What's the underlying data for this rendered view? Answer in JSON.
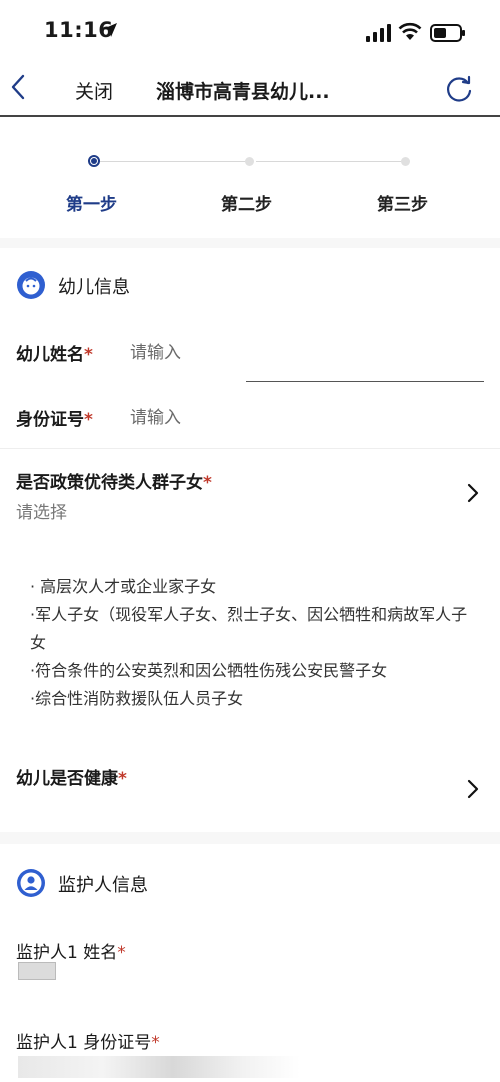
{
  "status_bar": {
    "time": "11:16"
  },
  "nav": {
    "close_label": "关闭",
    "title": "淄博市高青县幼儿..."
  },
  "steps": [
    {
      "label": "第一步",
      "active": true
    },
    {
      "label": "第二步",
      "active": false
    },
    {
      "label": "第三步",
      "active": false
    }
  ],
  "child_section": {
    "title": "幼儿信息",
    "name_label": "幼儿姓名",
    "name_placeholder": "请输入",
    "id_label": "身份证号",
    "id_placeholder": "请输入",
    "policy_label": "是否政策优待类人群子女",
    "policy_value": "请选择",
    "policy_items": [
      "· 高层次人才或企业家子女",
      "·军人子女（现役军人子女、烈士子女、因公牺牲和病故军人子女",
      "·符合条件的公安英烈和因公牺牲伤残公安民警子女",
      "·综合性消防救援队伍人员子女"
    ],
    "health_label": "幼儿是否健康"
  },
  "guardian_section": {
    "title": "监护人信息",
    "name_label": "监护人1 姓名",
    "id_label": "监护人1 身份证号"
  },
  "required_mark": "*",
  "colors": {
    "accent": "#1f3c88",
    "required": "#c0392b",
    "icon_blue": "#2f5fd0"
  },
  "icons": {
    "location": "location-arrow-icon",
    "back": "chevron-left-icon",
    "refresh": "refresh-icon",
    "child": "child-face-icon",
    "guardian": "person-icon",
    "chevron": "chevron-right-icon"
  }
}
